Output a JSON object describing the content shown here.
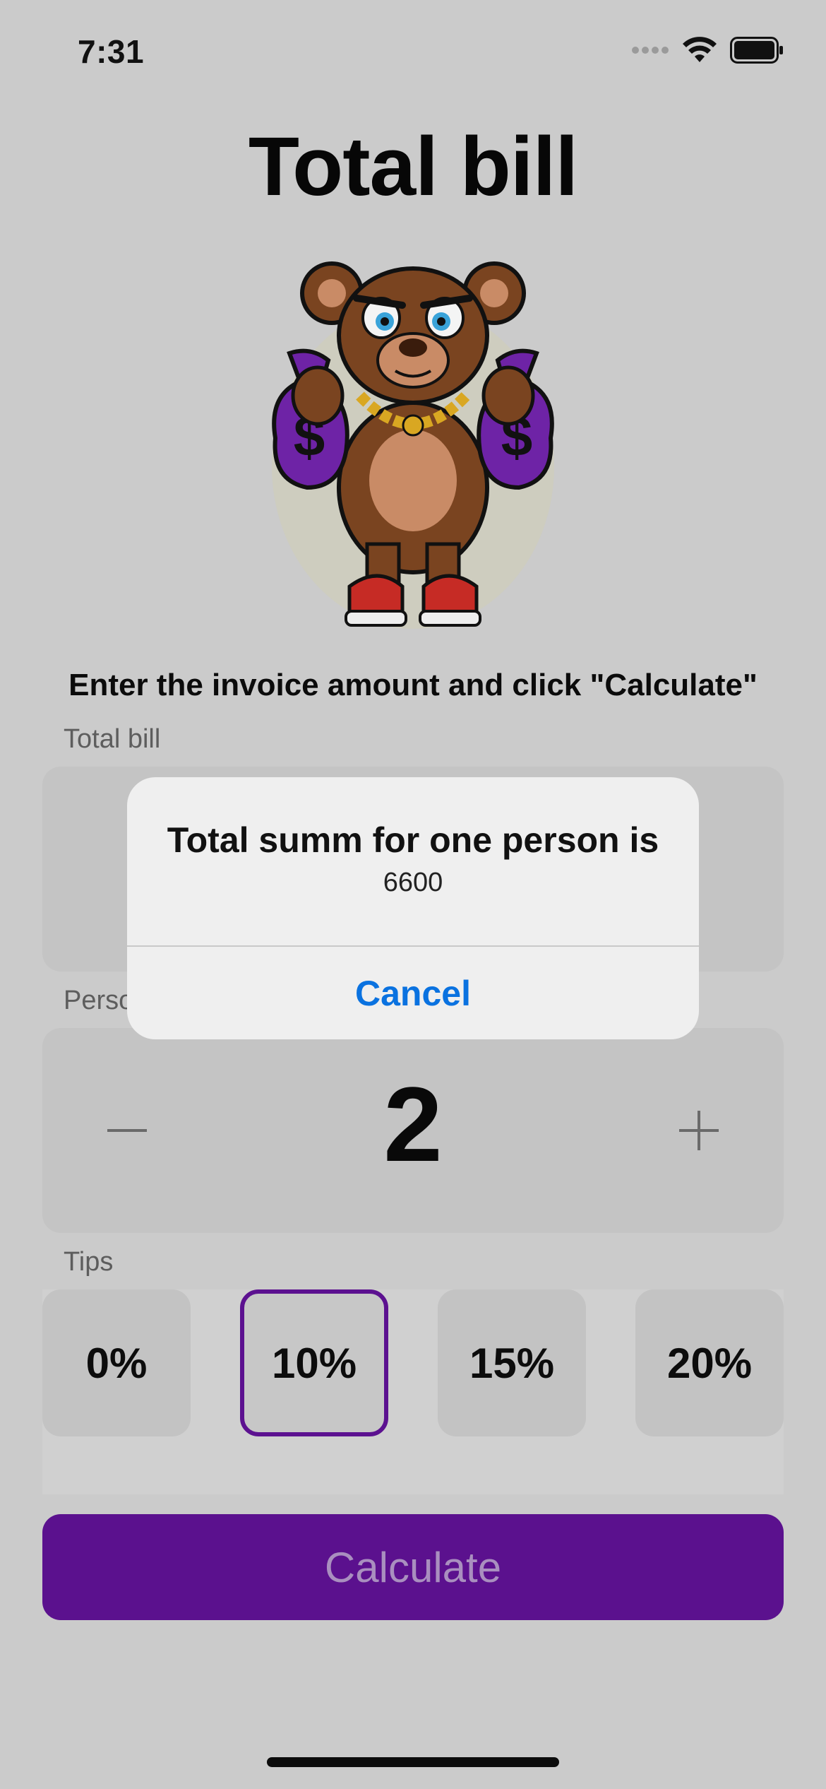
{
  "status_bar": {
    "time": "7:31"
  },
  "header": {
    "title": "Total bill"
  },
  "instruction": "Enter the invoice amount and click \"Calculate\"",
  "bill_section": {
    "label": "Total bill"
  },
  "persons_section": {
    "label": "Persons",
    "count": "2",
    "minus_icon": "minus-icon",
    "plus_icon": "plus-icon"
  },
  "tips_section": {
    "label": "Tips",
    "options": [
      "0%",
      "10%",
      "15%",
      "20%"
    ],
    "selected": "10%"
  },
  "calculate_button": {
    "label": "Calculate"
  },
  "alert": {
    "title": "Total summ for one person is",
    "message": "6600",
    "cancel_label": "Cancel"
  },
  "colors": {
    "accent": "#5b118e",
    "alert_button": "#0a72e0",
    "background": "#cbcbcb"
  }
}
